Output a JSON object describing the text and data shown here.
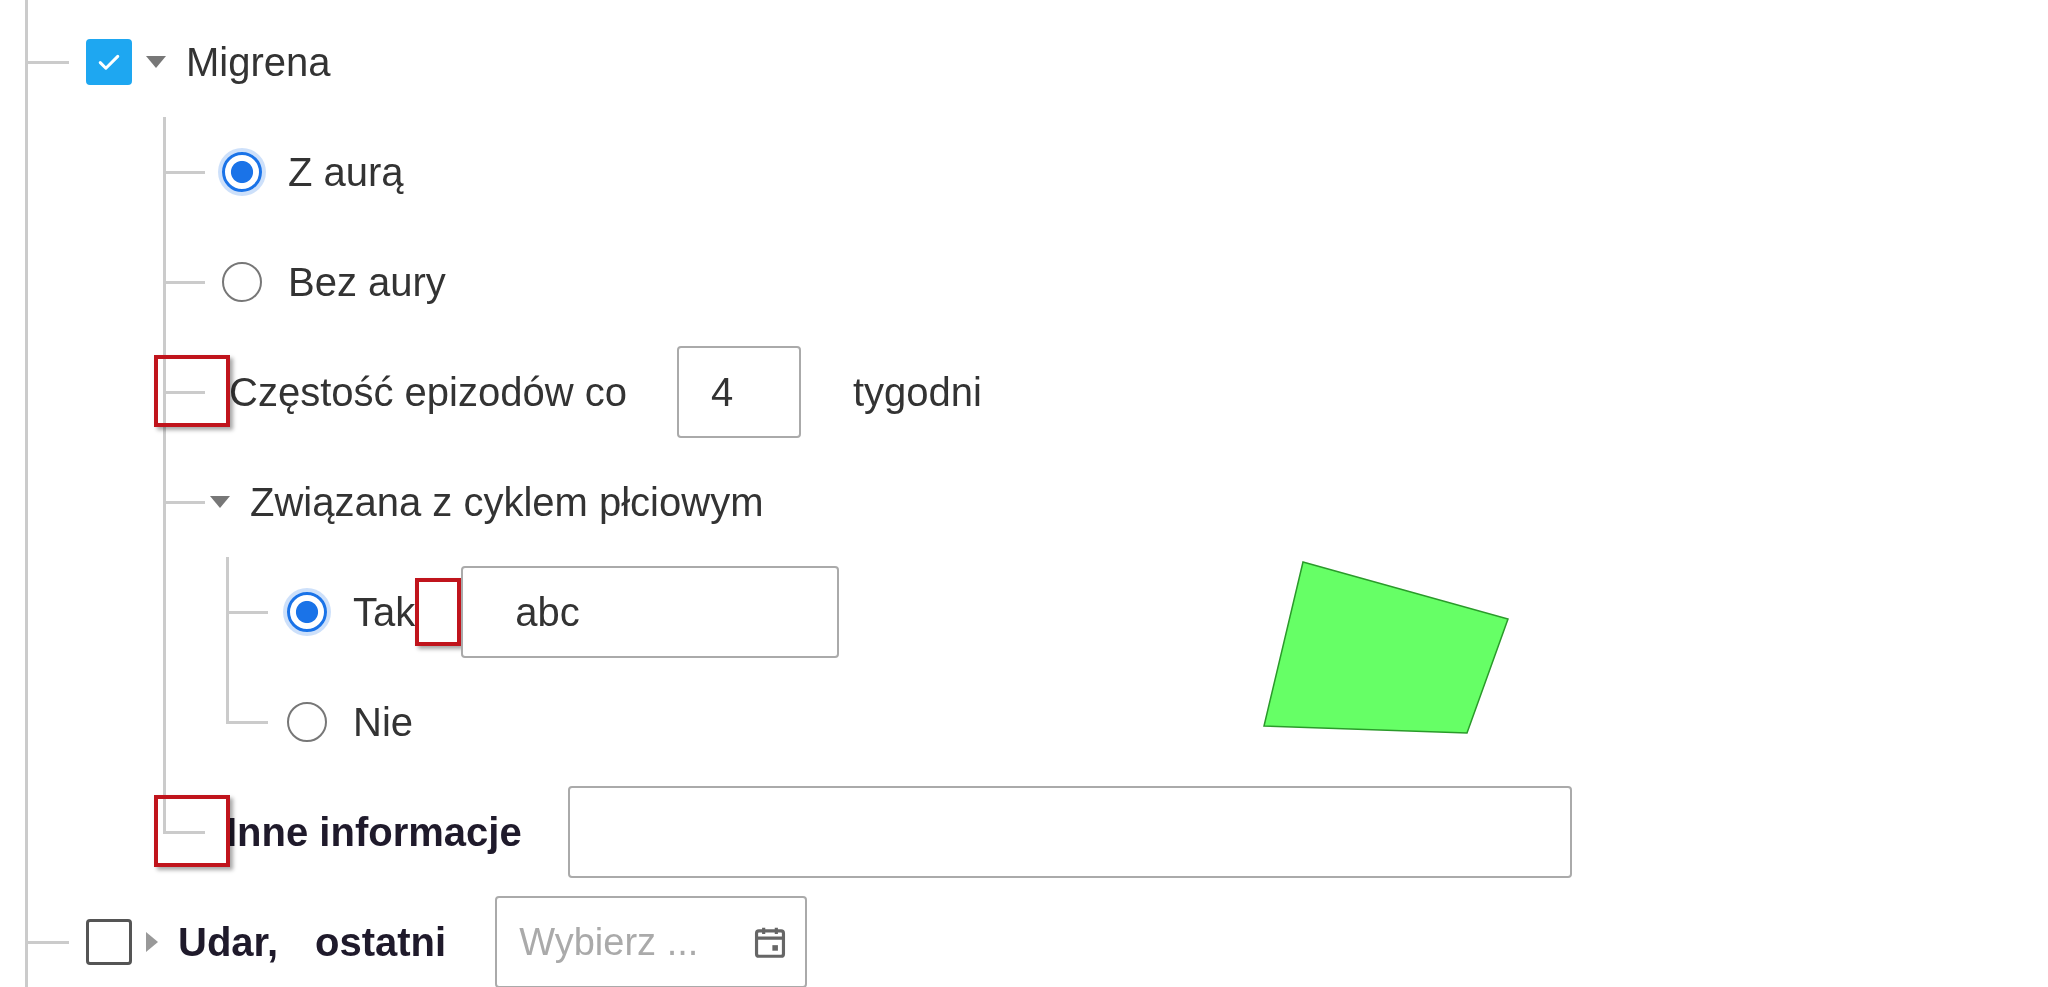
{
  "tree": [
    {
      "kind": "checkbox",
      "label": "Migrena",
      "checked": true,
      "expanded": true,
      "bold": false,
      "children": [
        {
          "kind": "radio",
          "label": "Z aurą",
          "selected": true
        },
        {
          "kind": "radio",
          "label": "Bez aury",
          "selected": false
        },
        {
          "kind": "number",
          "label": "Częstość epizodów co",
          "value": "4",
          "unit": "tygodni",
          "highlighted": true
        },
        {
          "kind": "group",
          "label": "Związana z cyklem płciowym",
          "expanded": true,
          "children": [
            {
              "kind": "radio",
              "label": "Tak",
              "selected": true,
              "value": "abc",
              "input_highlighted": true
            },
            {
              "kind": "radio",
              "label": "Nie",
              "selected": false
            }
          ]
        },
        {
          "kind": "text",
          "label": "Inne informacje",
          "highlighted": true
        }
      ]
    },
    {
      "kind": "checkbox",
      "label": "Udar,",
      "label_2": "ostatni",
      "checked": false,
      "expanded": false,
      "bold": true,
      "date_placeholder": "Wybierz ..."
    }
  ]
}
